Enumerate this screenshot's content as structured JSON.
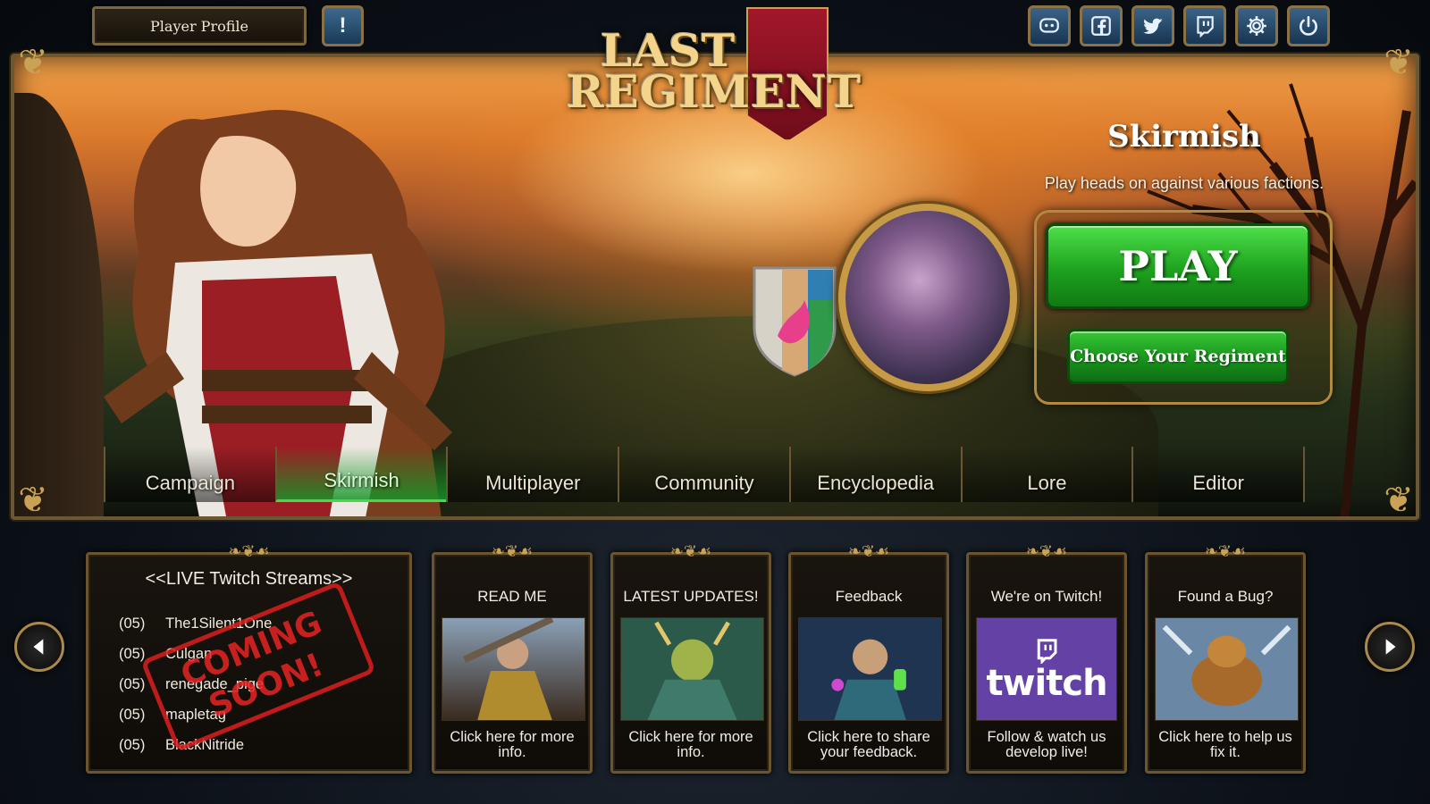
{
  "topbar": {
    "profile_label": "Player Profile",
    "alert_label": "!",
    "icons": [
      "discord-icon",
      "facebook-icon",
      "twitter-icon",
      "twitch-icon",
      "gear-icon",
      "power-icon"
    ]
  },
  "logo": {
    "line1": "LAST",
    "line2": "REGIMENT"
  },
  "mode": {
    "title": "Skirmish",
    "description": "Play heads on against various factions.",
    "play_label": "PLAY",
    "regiment_label": "Choose Your Regiment"
  },
  "tabs": [
    {
      "label": "Campaign"
    },
    {
      "label": "Skirmish",
      "active": true
    },
    {
      "label": "Multiplayer"
    },
    {
      "label": "Community"
    },
    {
      "label": "Encyclopedia"
    },
    {
      "label": "Lore"
    },
    {
      "label": "Editor"
    }
  ],
  "twitch_streams": {
    "title": "<<LIVE Twitch Streams>>",
    "stamp": "COMING SOON!",
    "streams": [
      {
        "count": "(05)",
        "name": "The1Silent1One"
      },
      {
        "count": "(05)",
        "name": "Culgan"
      },
      {
        "count": "(05)",
        "name": "renegade_pige"
      },
      {
        "count": "(05)",
        "name": "mapletag"
      },
      {
        "count": "(05)",
        "name": "BlackNitride"
      }
    ]
  },
  "cards": [
    {
      "title": "READ ME",
      "text": "Click here for more info."
    },
    {
      "title": "LATEST UPDATES!",
      "text": "Click here for more info."
    },
    {
      "title": "Feedback",
      "text": "Click here to share your feedback."
    },
    {
      "title": "We're on Twitch!",
      "text": "Follow & watch us develop live!"
    },
    {
      "title": "Found a Bug?",
      "text": "Click here to help us fix it."
    }
  ],
  "twitch_logo_text": "twitch",
  "colors": {
    "play_green": "#1da11e",
    "gold_frame": "#c9a255",
    "twitch_purple": "#6441a5",
    "active_tab": "#49d84a"
  }
}
